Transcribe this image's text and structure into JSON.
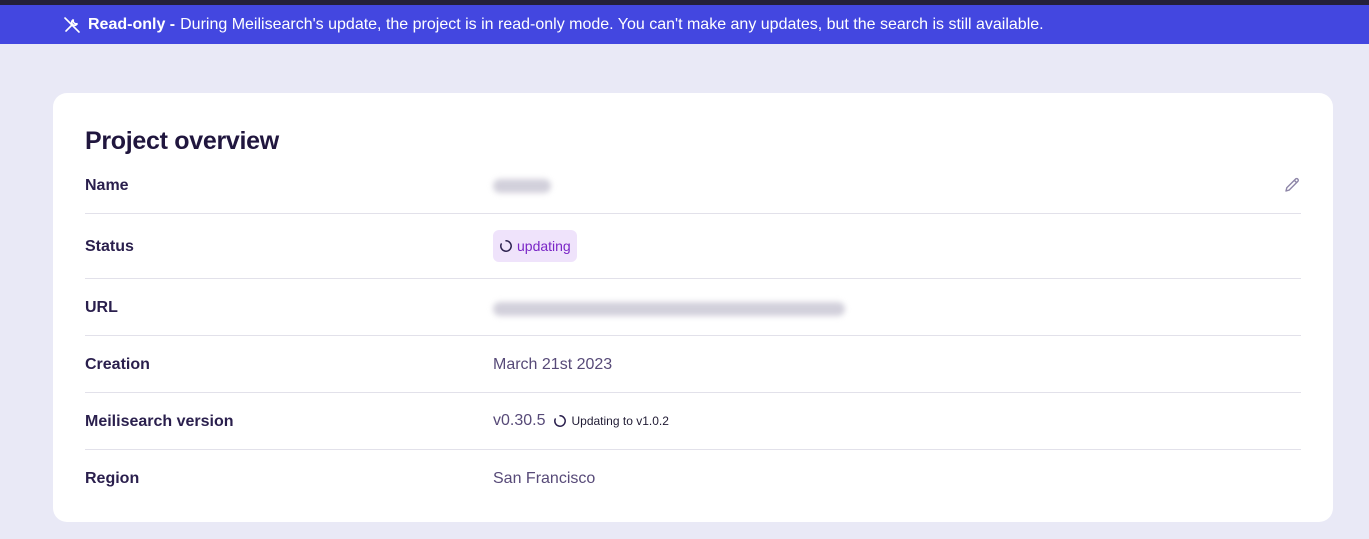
{
  "banner": {
    "strong": "Read-only -",
    "message": "During Meilisearch's update, the project is in read-only mode. You can't make any updates, but the search is still available.",
    "icon": "wrench-slash-icon"
  },
  "overview": {
    "title": "Project overview",
    "rows": [
      {
        "label": "Name",
        "value": ""
      },
      {
        "label": "Status",
        "value": "updating"
      },
      {
        "label": "URL",
        "value": ""
      },
      {
        "label": "Creation",
        "value": "March 21st 2023"
      },
      {
        "label": "Meilisearch version",
        "value": "v0.30.5",
        "update_note": "Updating to v1.0.2"
      },
      {
        "label": "Region",
        "value": "San Francisco"
      }
    ]
  },
  "colors": {
    "banner_bg": "#4347e0",
    "page_bg": "#e9e9f6",
    "badge_bg": "#efe3fb",
    "badge_text": "#7a26c6"
  }
}
